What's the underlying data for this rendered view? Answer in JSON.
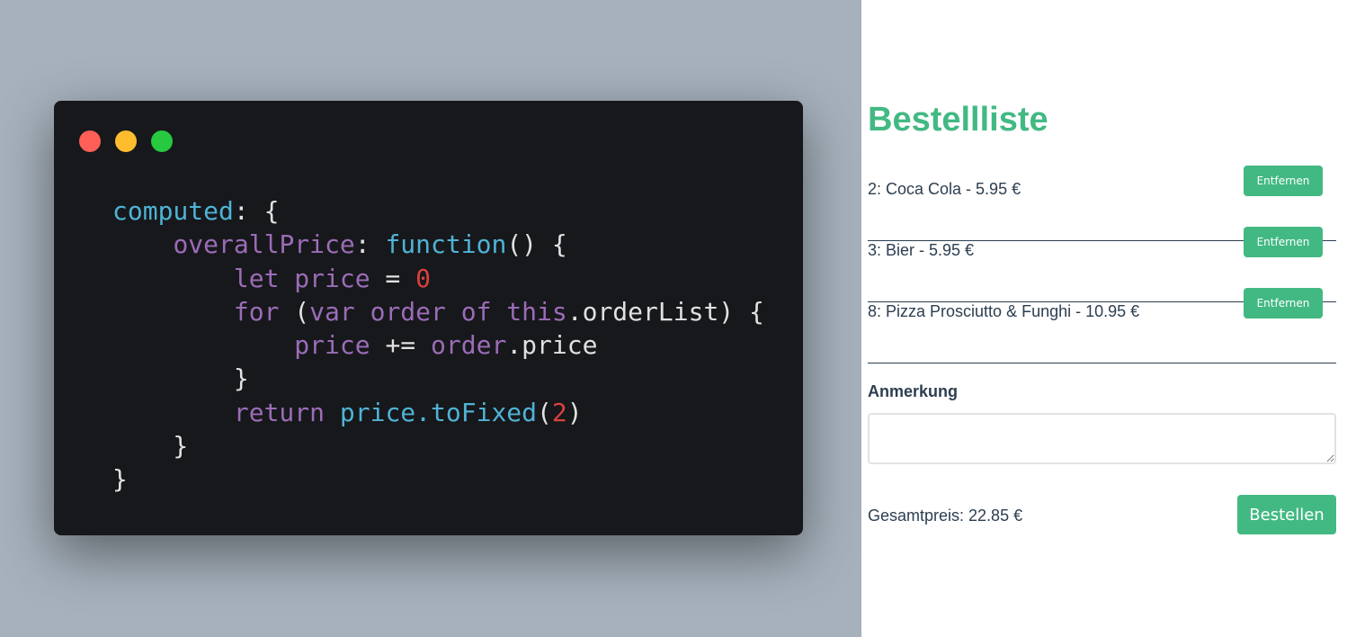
{
  "code_window": {
    "dots": {
      "close": "#ff5f56",
      "minimize": "#ffbd2e",
      "maximize": "#27c93f"
    },
    "lines": [
      [
        [
          "computed",
          "cyan"
        ],
        [
          ": {",
          "plain"
        ]
      ],
      [
        [
          "    ",
          "plain"
        ],
        [
          "overallPrice",
          "purple"
        ],
        [
          ": ",
          "plain"
        ],
        [
          "function",
          "cyan"
        ],
        [
          "() {",
          "plain"
        ]
      ],
      [
        [
          "        ",
          "plain"
        ],
        [
          "let price",
          "purple"
        ],
        [
          " = ",
          "plain"
        ],
        [
          "0",
          "red"
        ]
      ],
      [
        [
          "        ",
          "plain"
        ],
        [
          "for",
          "purple"
        ],
        [
          " (",
          "plain"
        ],
        [
          "var order of this",
          "purple"
        ],
        [
          ".orderList) {",
          "plain"
        ]
      ],
      [
        [
          "            ",
          "plain"
        ],
        [
          "price",
          "purple"
        ],
        [
          " += ",
          "plain"
        ],
        [
          "order",
          "purple"
        ],
        [
          ".price",
          "plain"
        ]
      ],
      [
        [
          "        }",
          "plain"
        ]
      ],
      [
        [
          "        ",
          "plain"
        ],
        [
          "return",
          "purple"
        ],
        [
          " ",
          "plain"
        ],
        [
          "price.toFixed",
          "cyan"
        ],
        [
          "(",
          "plain"
        ],
        [
          "2",
          "red"
        ],
        [
          ")",
          "plain"
        ]
      ],
      [
        [
          "    }",
          "plain"
        ]
      ],
      [
        [
          "}",
          "plain"
        ]
      ]
    ]
  },
  "order_panel": {
    "title": "Bestellliste",
    "items": [
      {
        "text": "2: Coca Cola - 5.95 €",
        "button": "Entfernen"
      },
      {
        "text": "3: Bier - 5.95 €",
        "button": "Entfernen"
      },
      {
        "text": "8: Pizza Prosciutto & Funghi - 10.95 €",
        "button": "Entfernen"
      }
    ],
    "note_label": "Anmerkung",
    "note_value": "",
    "total": "Gesamtpreis: 22.85 €",
    "order_button": "Bestellen",
    "accent": "#42b983"
  }
}
